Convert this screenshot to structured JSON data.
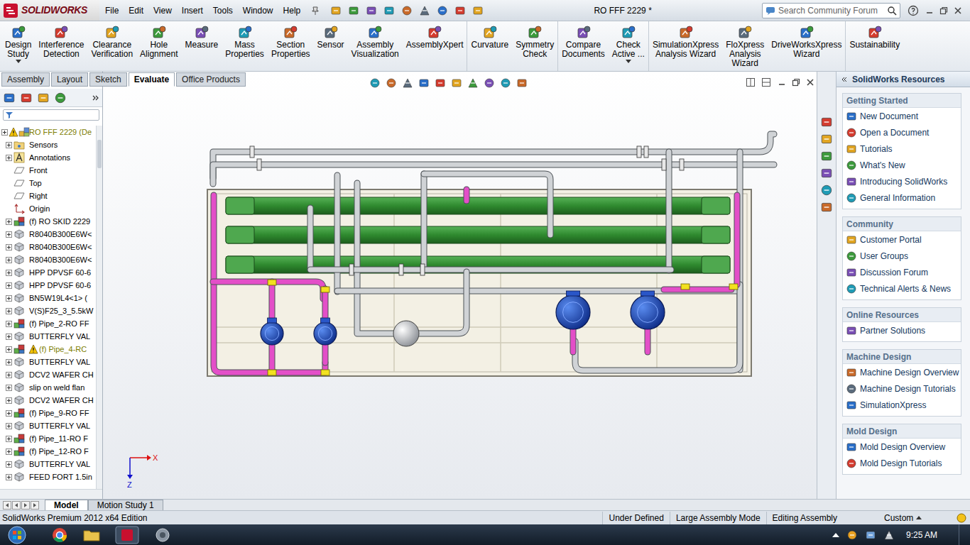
{
  "title_bar": {
    "logo": "SOLIDWORKS",
    "menus": [
      "File",
      "Edit",
      "View",
      "Insert",
      "Tools",
      "Window",
      "Help"
    ],
    "document_title": "RO FFF 2229 *",
    "search": {
      "placeholder": "Search Community Forum"
    }
  },
  "ribbon": {
    "groups": [
      [
        {
          "lines": [
            "Design",
            "Study"
          ],
          "dropdown": true
        },
        {
          "lines": [
            "Interference",
            "Detection"
          ],
          "dropdown": false
        },
        {
          "lines": [
            "Clearance",
            "Verification"
          ],
          "dropdown": false
        },
        {
          "lines": [
            "Hole",
            "Alignment"
          ],
          "dropdown": false
        },
        {
          "lines": [
            "Measure"
          ],
          "dropdown": false
        },
        {
          "lines": [
            "Mass",
            "Properties"
          ],
          "dropdown": false
        },
        {
          "lines": [
            "Section",
            "Properties"
          ],
          "dropdown": false
        },
        {
          "lines": [
            "Sensor"
          ],
          "dropdown": false
        },
        {
          "lines": [
            "Assembly",
            "Visualization"
          ],
          "dropdown": false
        },
        {
          "lines": [
            "AssemblyXpert"
          ],
          "dropdown": false
        }
      ],
      [
        {
          "lines": [
            "Curvature"
          ],
          "dropdown": false
        },
        {
          "lines": [
            "Symmetry",
            "Check"
          ],
          "dropdown": false
        }
      ],
      [
        {
          "lines": [
            "Compare",
            "Documents"
          ],
          "dropdown": false
        },
        {
          "lines": [
            "Check",
            "Active ..."
          ],
          "dropdown": true
        }
      ],
      [
        {
          "lines": [
            "SimulationXpress",
            "Analysis Wizard"
          ],
          "dropdown": false
        },
        {
          "lines": [
            "FloXpress",
            "Analysis",
            "Wizard"
          ],
          "dropdown": false
        },
        {
          "lines": [
            "DriveWorksXpress",
            "Wizard"
          ],
          "dropdown": false
        }
      ],
      [
        {
          "lines": [
            "Sustainability"
          ],
          "dropdown": false
        }
      ]
    ]
  },
  "command_tabs": [
    {
      "label": "Assembly",
      "selected": false
    },
    {
      "label": "Layout",
      "selected": false
    },
    {
      "label": "Sketch",
      "selected": false
    },
    {
      "label": "Evaluate",
      "selected": true
    },
    {
      "label": "Office Products",
      "selected": false
    }
  ],
  "feature_tree": {
    "items": [
      {
        "label": "RO FFF 2229 (De",
        "kind": "root",
        "warning": true,
        "expandable": true
      },
      {
        "label": "Sensors",
        "kind": "sensors",
        "warning": false,
        "expandable": true
      },
      {
        "label": "Annotations",
        "kind": "annotations",
        "warning": false,
        "expandable": true
      },
      {
        "label": "Front",
        "kind": "plane",
        "warning": false,
        "expandable": false
      },
      {
        "label": "Top",
        "kind": "plane",
        "warning": false,
        "expandable": false
      },
      {
        "label": "Right",
        "kind": "plane",
        "warning": false,
        "expandable": false
      },
      {
        "label": "Origin",
        "kind": "origin",
        "warning": false,
        "expandable": false
      },
      {
        "label": "(f) RO SKID 2229",
        "kind": "subassembly",
        "warning": false,
        "expandable": true
      },
      {
        "label": "R8040B300E6W<",
        "kind": "part",
        "warning": false,
        "expandable": true
      },
      {
        "label": "R8040B300E6W<",
        "kind": "part",
        "warning": false,
        "expandable": true
      },
      {
        "label": "R8040B300E6W<",
        "kind": "part",
        "warning": false,
        "expandable": true
      },
      {
        "label": "HPP DPVSF 60-6",
        "kind": "part",
        "warning": false,
        "expandable": true
      },
      {
        "label": "HPP DPVSF 60-6",
        "kind": "part",
        "warning": false,
        "expandable": true
      },
      {
        "label": "BN5W19L4<1> (",
        "kind": "part",
        "warning": false,
        "expandable": true
      },
      {
        "label": "V(S)F25_3_5.5kW",
        "kind": "part",
        "warning": false,
        "expandable": true
      },
      {
        "label": "(f) Pipe_2-RO FF",
        "kind": "subassembly",
        "warning": false,
        "expandable": true
      },
      {
        "label": "BUTTERFLY VAL",
        "kind": "part",
        "warning": false,
        "expandable": true
      },
      {
        "label": "(f) Pipe_4-RC",
        "kind": "subassembly",
        "warning": true,
        "expandable": true
      },
      {
        "label": "BUTTERFLY VAL",
        "kind": "part",
        "warning": false,
        "expandable": true
      },
      {
        "label": "DCV2 WAFER CH",
        "kind": "part",
        "warning": false,
        "expandable": true
      },
      {
        "label": "slip on weld flan",
        "kind": "part",
        "warning": false,
        "expandable": true
      },
      {
        "label": "DCV2 WAFER CH",
        "kind": "part",
        "warning": false,
        "expandable": true
      },
      {
        "label": "(f) Pipe_9-RO FF",
        "kind": "subassembly",
        "warning": false,
        "expandable": true
      },
      {
        "label": "BUTTERFLY VAL",
        "kind": "part",
        "warning": false,
        "expandable": true
      },
      {
        "label": "(f) Pipe_11-RO F",
        "kind": "subassembly",
        "warning": false,
        "expandable": true
      },
      {
        "label": "(f) Pipe_12-RO F",
        "kind": "subassembly",
        "warning": false,
        "expandable": true
      },
      {
        "label": "BUTTERFLY VAL",
        "kind": "part",
        "warning": false,
        "expandable": true
      },
      {
        "label": "FEED FORT 1.5in",
        "kind": "part",
        "warning": false,
        "expandable": true
      }
    ]
  },
  "viewport": {
    "axes": {
      "x": "X",
      "z": "Z"
    }
  },
  "task_pane": {
    "title": "SolidWorks Resources",
    "sections": [
      {
        "title": "Getting Started",
        "items": [
          "New Document",
          "Open a Document",
          "Tutorials",
          "What's New",
          "Introducing SolidWorks",
          "General Information"
        ]
      },
      {
        "title": "Community",
        "items": [
          "Customer Portal",
          "User Groups",
          "Discussion Forum",
          "Technical Alerts & News"
        ]
      },
      {
        "title": "Online Resources",
        "items": [
          "Partner Solutions"
        ]
      },
      {
        "title": "Machine Design",
        "items": [
          "Machine Design Overview",
          "Machine Design Tutorials",
          "SimulationXpress"
        ]
      },
      {
        "title": "Mold Design",
        "items": [
          "Mold Design Overview",
          "Mold Design Tutorials"
        ]
      }
    ]
  },
  "bottom_tabs": [
    {
      "label": "Model",
      "selected": true
    },
    {
      "label": "Motion Study 1",
      "selected": false
    }
  ],
  "status_bar": {
    "edition": "SolidWorks Premium 2012 x64 Edition",
    "items": [
      "Under Defined",
      "Large Assembly Mode",
      "Editing Assembly"
    ],
    "units": "Custom"
  },
  "taskbar": {
    "time": "9:25 AM"
  }
}
